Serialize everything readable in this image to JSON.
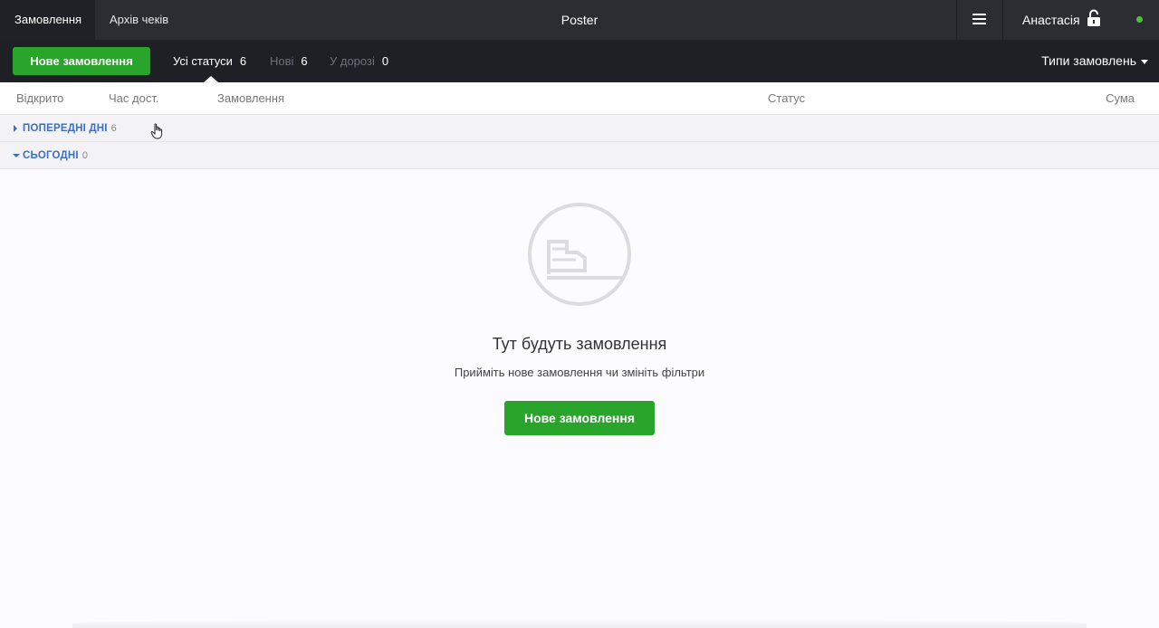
{
  "topbar": {
    "tabs": [
      {
        "label": "Замовлення",
        "active": true
      },
      {
        "label": "Архів чеків",
        "active": false
      }
    ],
    "title": "Poster",
    "user_name": "Анастасія",
    "icons": {
      "menu": "hamburger-icon",
      "lock": "unlocked-padlock-icon",
      "status": "online-dot"
    },
    "online_color": "#4fbf3b"
  },
  "filterbar": {
    "new_order_label": "Нове замовлення",
    "statuses": [
      {
        "label": "Усі статуси",
        "count": "6",
        "active": true
      },
      {
        "label": "Нові",
        "count": "6",
        "active": false
      },
      {
        "label": "У дорозі",
        "count": "0",
        "active": false
      }
    ],
    "types_label": "Типи замовлень"
  },
  "columns": [
    "Відкрито",
    "Час дост.",
    "Замовлення",
    "Статус",
    "Сума"
  ],
  "groups": [
    {
      "label": "ПОПЕРЕДНІ ДНІ",
      "count": "6",
      "expanded": false
    },
    {
      "label": "СЬОГОДНІ",
      "count": "0",
      "expanded": true
    }
  ],
  "empty_state": {
    "icon": "boot-in-circle-icon",
    "title": "Тут будуть замовлення",
    "subtitle": "Прийміть нове замовлення чи змініть фільтри",
    "button_label": "Нове замовлення"
  },
  "colors": {
    "accent_green": "#2aa52c",
    "link_blue": "#3a6fc4",
    "topbar_bg": "#2b2d33",
    "filterbar_bg": "#1e2026"
  }
}
